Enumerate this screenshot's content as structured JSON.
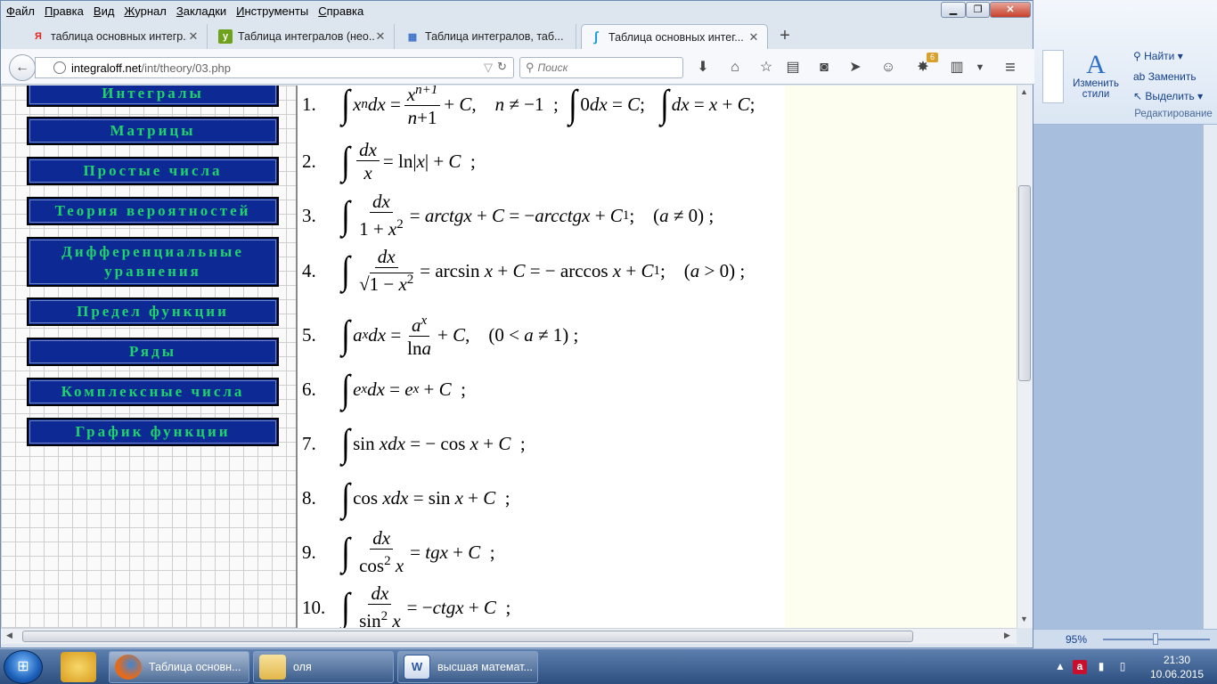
{
  "menu": [
    "Файл",
    "Правка",
    "Вид",
    "Журнал",
    "Закладки",
    "Инструменты",
    "Справка"
  ],
  "menu_underline": [
    "Ф",
    "П",
    "В",
    "Ж",
    "З",
    "И",
    "С"
  ],
  "menu_rest": [
    "айл",
    "равка",
    "ид",
    "урнал",
    "акладки",
    "нструменты",
    "правка"
  ],
  "tabs": [
    {
      "fav": "Я",
      "favColor": "#e3221c",
      "title": "таблица основных интегр..."
    },
    {
      "fav": "y",
      "favColor": "#6fa21c",
      "title": "Таблица интегралов (нео..."
    },
    {
      "fav": "▦",
      "favColor": "#3f74c8",
      "title": "Таблица интегралов, таб..."
    },
    {
      "fav": "∫",
      "favColor": "#1a9fd1",
      "title": "Таблица основных интег..."
    }
  ],
  "new_tab": "+",
  "url": {
    "host": "integraloff.net",
    "path": "/int/theory/03.php"
  },
  "search_placeholder": "Поиск",
  "badge_count": "6",
  "nav_buttons": [
    "Интегралы",
    "Матрицы",
    "Простые числа",
    "Теория вероятностей",
    "Дифференциальные уравнения",
    "Предел функции",
    "Ряды",
    "Комплексные числа",
    "График функции"
  ],
  "formulas": {
    "n1": "1.",
    "n2": "2.",
    "n3": "3.",
    "n4": "4.",
    "n5": "5.",
    "n6": "6.",
    "n7": "7.",
    "n8": "8.",
    "n9": "9.",
    "n10": "10."
  },
  "word": {
    "find": "Найти",
    "replace": "Заменить",
    "select": "Выделить",
    "change_styles_1": "Изменить",
    "change_styles_2": "стили",
    "editing": "Редактирование",
    "zoom": "95%"
  },
  "taskbar": {
    "firefox": "Таблица основн...",
    "folder": "оля",
    "word": "высшая математ...",
    "time": "21:30",
    "date": "10.06.2015"
  }
}
